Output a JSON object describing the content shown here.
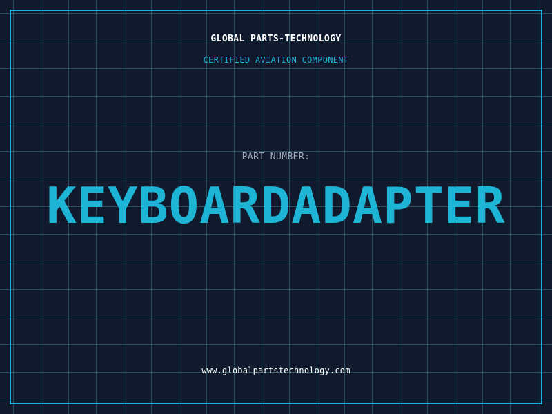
{
  "header": {
    "brand": "GLOBAL PARTS-TECHNOLOGY",
    "tagline": "CERTIFIED AVIATION COMPONENT"
  },
  "part": {
    "label": "PART NUMBER:",
    "number": "KEYBOARDADAPTER"
  },
  "footer": {
    "website": "www.globalpartstechnology.com"
  },
  "colors": {
    "background": "#111a2c",
    "accent": "#1eb4d6",
    "grid": "#40aabe",
    "label": "#9aa8b8",
    "text": "#ffffff"
  }
}
